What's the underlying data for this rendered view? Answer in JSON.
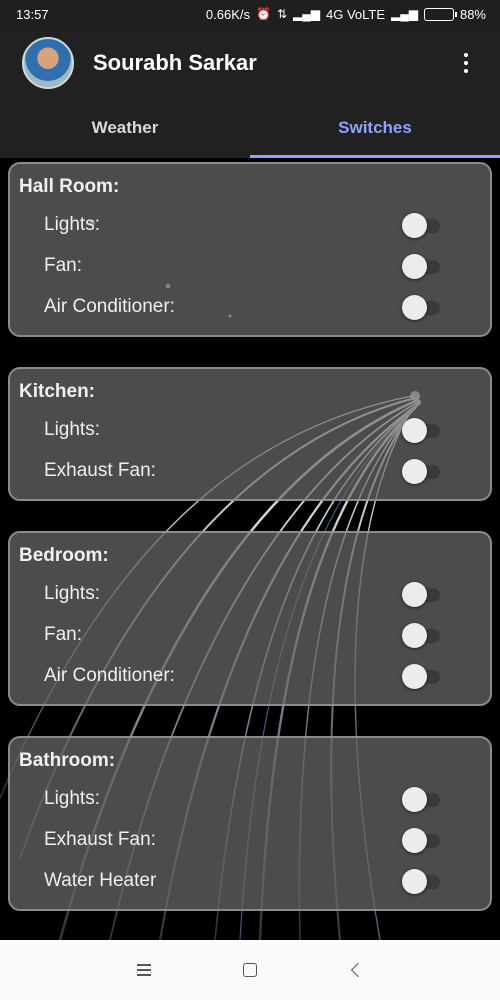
{
  "status_bar": {
    "time": "13:57",
    "network_speed": "0.66K/s",
    "network_type": "4G VoLTE",
    "battery": "88%",
    "battery_level": 0.88
  },
  "app_bar": {
    "title": "Sourabh Sarkar",
    "avatar_icon": "avatar",
    "menu_icon": "more-vert-icon"
  },
  "tabs": [
    {
      "label": "Weather",
      "active": false
    },
    {
      "label": "Switches",
      "active": true
    }
  ],
  "accent_color": "#8ea2ff",
  "rooms": [
    {
      "title": "Hall Room:",
      "switches": [
        {
          "label": "Lights:",
          "on": false
        },
        {
          "label": "Fan:",
          "on": false
        },
        {
          "label": "Air Conditioner:",
          "on": false
        }
      ]
    },
    {
      "title": "Kitchen:",
      "switches": [
        {
          "label": "Lights:",
          "on": false
        },
        {
          "label": "Exhaust Fan:",
          "on": false
        }
      ]
    },
    {
      "title": "Bedroom:",
      "switches": [
        {
          "label": "Lights:",
          "on": false
        },
        {
          "label": "Fan:",
          "on": false
        },
        {
          "label": "Air Conditioner:",
          "on": false
        }
      ]
    },
    {
      "title": "Bathroom:",
      "switches": [
        {
          "label": "Lights:",
          "on": false
        },
        {
          "label": "Exhaust Fan:",
          "on": false
        },
        {
          "label": "Water Heater",
          "on": false
        }
      ]
    }
  ],
  "nav_bar": {
    "icons": [
      "menu-icon",
      "home-icon",
      "back-icon"
    ]
  }
}
